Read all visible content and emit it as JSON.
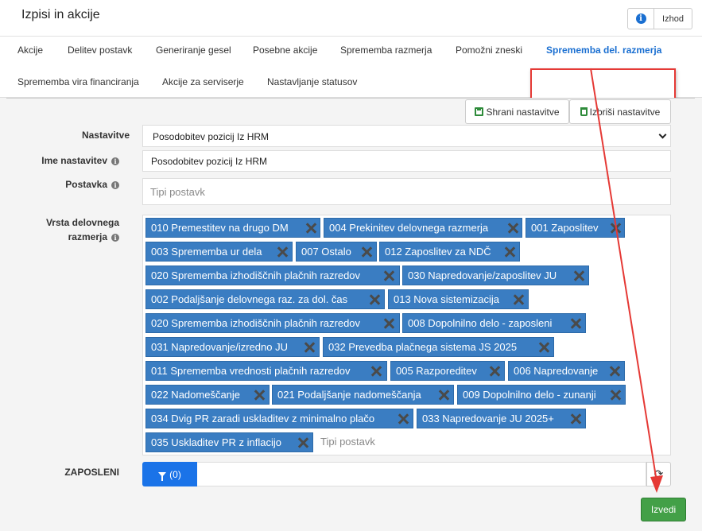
{
  "page": {
    "title": "Izpisi in akcije"
  },
  "header_buttons": {
    "info_icon": "info-icon",
    "exit_label": "Izhod"
  },
  "tabs": [
    {
      "label": "Akcije",
      "active": false
    },
    {
      "label": "Delitev postavk",
      "active": false
    },
    {
      "label": "Generiranje gesel",
      "active": false
    },
    {
      "label": "Posebne akcije",
      "active": false
    },
    {
      "label": "Sprememba razmerja",
      "active": false
    },
    {
      "label": "Pomožni zneski",
      "active": false
    },
    {
      "label": "Sprememba del. razmerja",
      "active": true
    },
    {
      "label": "Sprememba vira financiranja",
      "active": false
    },
    {
      "label": "Akcije za serviserje",
      "active": false
    },
    {
      "label": "Nastavljanje statusov",
      "active": false
    }
  ],
  "toolbar": {
    "save_label": "Shrani nastavitve",
    "delete_label": "Izbriši nastavitve"
  },
  "form": {
    "settings_label": "Nastavitve",
    "settings_value": "Posodobitev pozicij Iz HRM",
    "name_label": "Ime nastavitev",
    "name_value": "Posodobitev pozicij Iz HRM",
    "item_label": "Postavka",
    "item_placeholder": "Tipi postavk",
    "type_label_line1": "Vrsta delovnega",
    "type_label_line2": "razmerja",
    "tags": [
      "010 Premestitev na drugo DM",
      "004 Prekinitev delovnega razmerja",
      "001 Zaposlitev",
      "003 Sprememba ur dela",
      "007 Ostalo",
      "012 Zaposlitev za NDČ",
      "020 Sprememba izhodiščnih plačnih razredov",
      "030 Napredovanje/zaposlitev JU",
      "002 Podaljšanje delovnega raz. za dol. čas",
      "013 Nova sistemizacija",
      "020 Sprememba izhodiščnih plačnih razredov",
      "008 Dopolnilno delo - zaposleni",
      "031 Napredovanje/izredno JU",
      "032 Prevedba plačnega sistema JS 2025",
      "011 Sprememba vrednosti plačnih razredov",
      "005 Razporeditev",
      "006 Napredovanje",
      "022 Nadomeščanje",
      "021 Podaljšanje nadomeščanja",
      "009 Dopolnilno delo - zunanji",
      "034 Dvig PR zaradi uskladitev z minimalno plačo",
      "033 Napredovanje JU 2025+",
      "035 Uskladitev PR z inflacijo"
    ],
    "tags_placeholder": "Tipi postavk",
    "employees_label": "ZAPOSLENI",
    "filter_count": "(0)"
  },
  "actions": {
    "run_label": "Izvedi"
  },
  "colors": {
    "accent": "#1a6fd1",
    "tag_bg": "#3a7dc2",
    "run": "#43a047",
    "annotation": "#e53935"
  }
}
